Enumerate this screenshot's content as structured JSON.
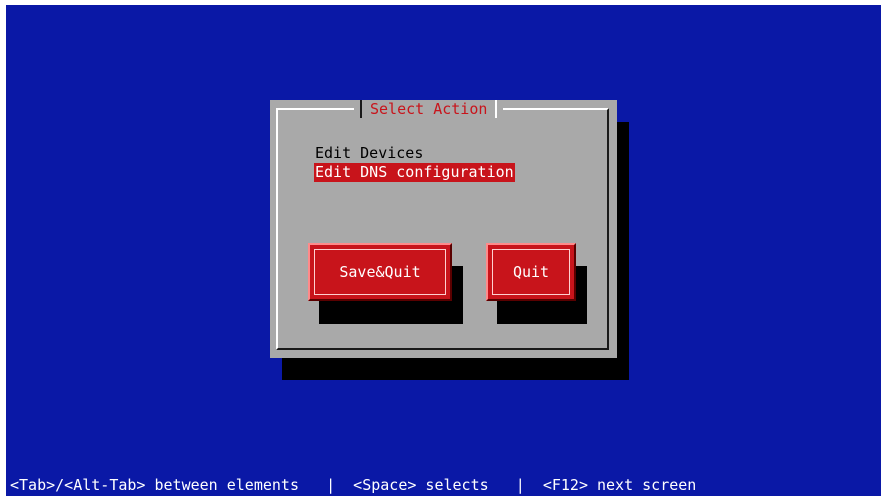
{
  "dialog": {
    "title": "Select Action",
    "items": [
      {
        "label": "Edit Devices",
        "selected": false
      },
      {
        "label": "Edit DNS configuration",
        "selected": true
      }
    ],
    "buttons": {
      "save_quit": "Save&Quit",
      "quit": "Quit"
    }
  },
  "status_bar": {
    "text": "<Tab>/<Alt-Tab> between elements   |  <Space> selects   |  <F12> next screen"
  },
  "colors": {
    "background": "#0a18a6",
    "dialog": "#a9a9a9",
    "accent": "#c8141b"
  }
}
